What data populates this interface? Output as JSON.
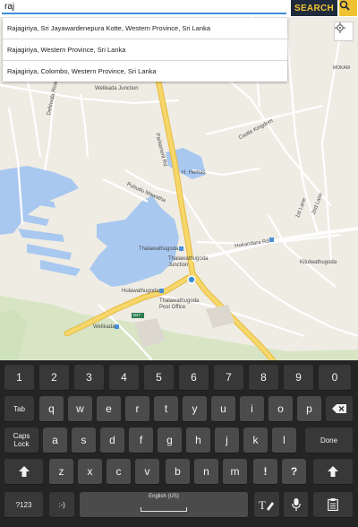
{
  "search": {
    "query": "raj",
    "button_label": "SEARCH"
  },
  "suggestions": [
    "Rajagiriya, Sri Jayawardenepura Kotte, Western Province, Sri Lanka",
    "Rajagiriya, Western Province, Sri Lanka",
    "Rajagiriya, Colombo, Western Province, Sri Lanka"
  ],
  "map": {
    "labels": {
      "welikada_junction": "Welikada Junction",
      "ramanathan_rd": "Parliament Rd",
      "sri_lanka_1": "Dehiwala Road",
      "hemas": "H. Hemas",
      "pubudu_rd": "Pubudu Mawatha",
      "castle_kingdom": "Castle Kingdom",
      "thalawathugoda": "Thalawathugoda",
      "thalawathugoda_junction": "Thalawathugoda Junction",
      "kitulwathugoda": "Kitulwathugoda",
      "kotte_rd": "Hokandara Rd",
      "hulawathugoda": "Hulawathugoda",
      "post_office": "Thalawathugoda Post Office",
      "welikada": "Welikada",
      "lane_2nd": "2nd Lane",
      "lane_1st": "1st Lane",
      "mokam": "MOKAM",
      "a0_badge": "B47",
      "b_badge": "B47",
      "hokandara": "Hokandara Rd"
    }
  },
  "keyboard": {
    "numbers": [
      "1",
      "2",
      "3",
      "4",
      "5",
      "6",
      "7",
      "8",
      "9",
      "0"
    ],
    "row1": [
      "q",
      "w",
      "e",
      "r",
      "t",
      "y",
      "u",
      "i",
      "o",
      "p"
    ],
    "row1_subs": [
      "",
      "",
      "",
      "",
      "",
      "",
      "",
      "",
      "",
      ""
    ],
    "row2": [
      "a",
      "s",
      "d",
      "f",
      "g",
      "h",
      "j",
      "k",
      "l"
    ],
    "row3": [
      "z",
      "x",
      "c",
      "v",
      "b",
      "n",
      "m",
      "!",
      "?"
    ],
    "tab": "Tab",
    "caps_line1": "Caps",
    "caps_line2": "Lock",
    "done": "Done",
    "sym": "?123",
    "emoji": ":-)",
    "space_label": "English (US)"
  },
  "colors": {
    "search_bg": "#1f2a3c",
    "accent": "#f0c233",
    "road_major": "#f6d76b",
    "water": "#a8c8f0",
    "keyboard_bg": "#242424",
    "key_bg": "#4b4b4b"
  }
}
